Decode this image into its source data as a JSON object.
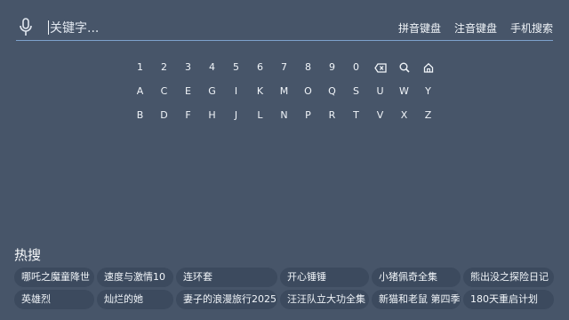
{
  "search": {
    "placeholder": "关键字...",
    "modes": [
      "拼音键盘",
      "注音键盘",
      "手机搜索"
    ]
  },
  "keyboard": {
    "digits": [
      "1",
      "2",
      "3",
      "4",
      "5",
      "6",
      "7",
      "8",
      "9",
      "0"
    ],
    "row2": [
      "A",
      "C",
      "E",
      "G",
      "I",
      "K",
      "M",
      "O",
      "Q",
      "S",
      "U",
      "W",
      "Y"
    ],
    "row3": [
      "B",
      "D",
      "F",
      "H",
      "J",
      "L",
      "N",
      "P",
      "R",
      "T",
      "V",
      "X",
      "Z"
    ],
    "icons": [
      "backspace-icon",
      "search-icon",
      "home-icon"
    ]
  },
  "hot": {
    "title": "热搜",
    "items": [
      "哪吒之魔童降世",
      "速度与激情10",
      "连环套",
      "开心锤锤",
      "小猪佩奇全集",
      "熊出没之探险日记",
      "英雄烈",
      "灿烂的她",
      "妻子的浪漫旅行2025",
      "汪汪队立大功全集",
      "新猫和老鼠 第四季",
      "180天重启计划"
    ]
  }
}
